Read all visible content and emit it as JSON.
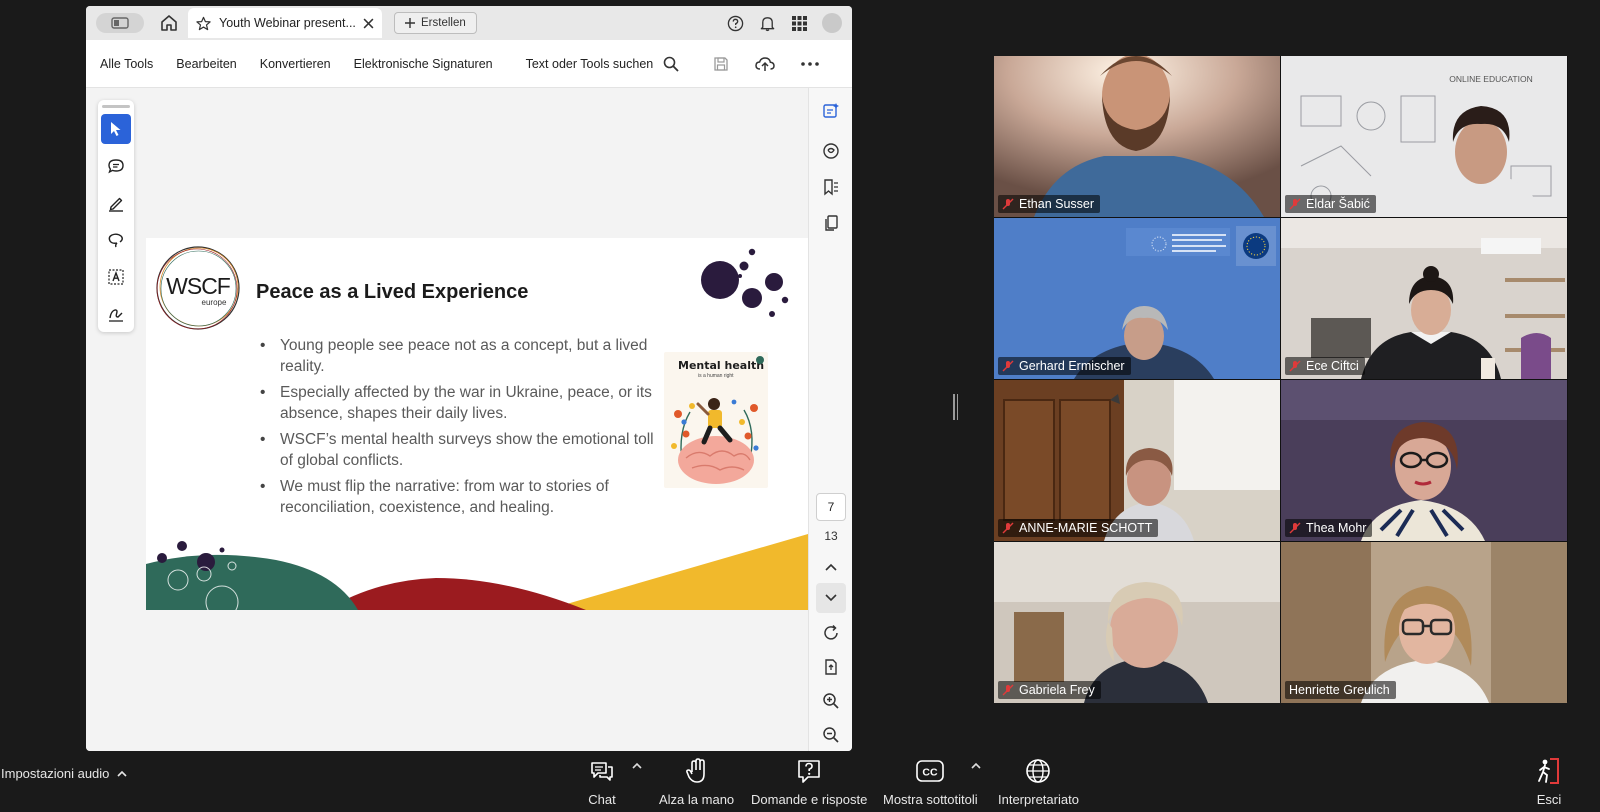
{
  "acrobat": {
    "tab_title": "Youth Webinar present...",
    "new_button": "Erstellen",
    "menu": [
      "Alle Tools",
      "Bearbeiten",
      "Konvertieren",
      "Elektronische Signaturen"
    ],
    "search_label": "Text oder Tools suchen",
    "current_page": "7",
    "total_pages": "13"
  },
  "slide": {
    "logo_text": "WSCF",
    "logo_sub": "europe",
    "title": "Peace as a Lived Experience",
    "bullets": [
      "Young people see peace not as a concept, but a lived reality.",
      "Especially affected by the war in Ukraine, peace, or its absence, shapes their daily lives.",
      "WSCF’s mental health surveys show the emotional toll of global conflicts.",
      "We must flip the narrative: from war to stories of reconciliation, coexistence, and healing."
    ],
    "image_title": "Mental health",
    "image_subtitle": "is a human right"
  },
  "participants": [
    {
      "name": "Ethan Susser",
      "muted": true
    },
    {
      "name": "Eldar Šabić",
      "muted": true
    },
    {
      "name": "Gerhard Ermischer",
      "muted": true
    },
    {
      "name": "Ece Ciftci",
      "muted": true
    },
    {
      "name": "ANNE-MARIE SCHOTT",
      "muted": true
    },
    {
      "name": "Thea Mohr",
      "muted": true
    },
    {
      "name": "Gabriela Frey",
      "muted": true
    },
    {
      "name": "Henriette Greulich",
      "muted": false,
      "speaking": true
    }
  ],
  "toolbar": {
    "audio_settings": "Impostazioni audio",
    "chat": "Chat",
    "raise_hand": "Alza la mano",
    "qa": "Domande e risposte",
    "captions": "Mostra sottotitoli",
    "interpretation": "Interpretariato",
    "leave": "Esci"
  },
  "colors": {
    "active_speaker": "#3ad98b",
    "tool_active": "#2b63d9",
    "slide_green": "#2f6a5a",
    "slide_red": "#9b1b1f",
    "slide_yellow": "#f1b92c",
    "slide_dots": "#2a1b3d",
    "leave_red": "#e03a3a"
  }
}
